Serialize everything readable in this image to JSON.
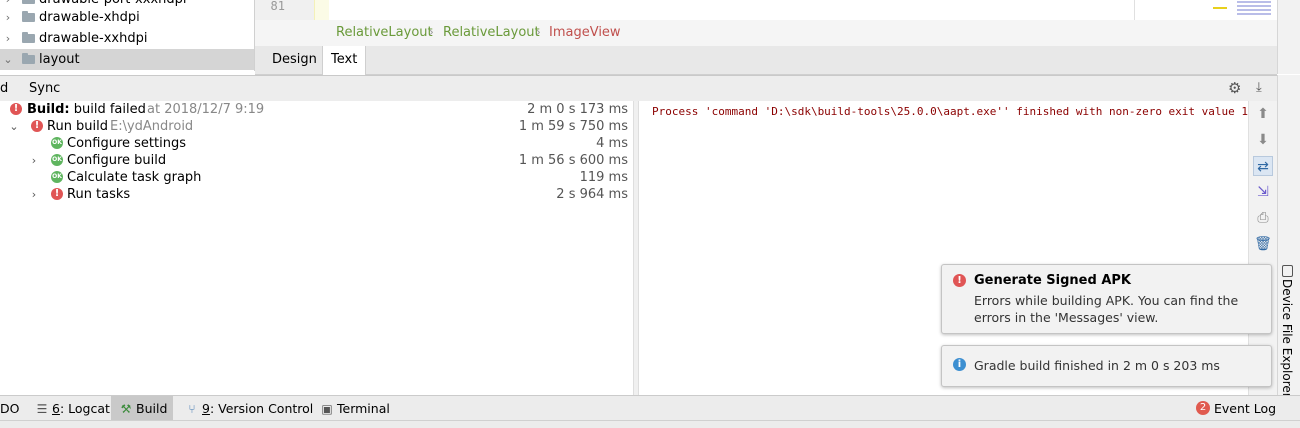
{
  "project_tree": {
    "items": [
      {
        "label": "drawable-port-xxxhdpi",
        "chevron": "›"
      },
      {
        "label": "drawable-xhdpi",
        "chevron": "›"
      },
      {
        "label": "drawable-xxhdpi",
        "chevron": "›"
      },
      {
        "label": "layout",
        "chevron": "⌄"
      }
    ]
  },
  "editor": {
    "line_number": "81",
    "breadcrumb": [
      "RelativeLayout",
      "RelativeLayout",
      "ImageView"
    ],
    "breadcrumb_colors": {
      "layout": "#6a9a3a",
      "view": "#c0504d"
    },
    "tabs": [
      "Design",
      "Text"
    ],
    "active_tab": "Text"
  },
  "build_window": {
    "header_tabs": [
      "d",
      "Sync"
    ],
    "tree": [
      {
        "name_bold": "Build:",
        "name": "build failed",
        "detail": "at 2018/12/7 9:19",
        "time": "2 m 0 s 173 ms",
        "status": "error"
      },
      {
        "name": "Run build",
        "detail": "E:\\ydAndroid",
        "time": "1 m 59 s 750 ms",
        "status": "error",
        "chevron": "⌄"
      },
      {
        "name": "Configure settings",
        "time": "4 ms",
        "status": "ok"
      },
      {
        "name": "Configure build",
        "time": "1 m 56 s 600 ms",
        "status": "ok",
        "chevron": "›"
      },
      {
        "name": "Calculate task graph",
        "time": "119 ms",
        "status": "ok"
      },
      {
        "name": "Run tasks",
        "time": "2 s 964 ms",
        "status": "error",
        "chevron": "›"
      }
    ],
    "ok_label": "OK",
    "error_label": "!",
    "console": "Process 'command 'D:\\sdk\\build-tools\\25.0.0\\aapt.exe'' finished with non-zero exit value 1"
  },
  "notifications": [
    {
      "title": "Generate Signed APK",
      "message": "Errors while building APK. You can find the errors in the 'Messages' view.",
      "type": "error",
      "color": "#e05555"
    },
    {
      "title": "",
      "message": "Gradle build finished in 2 m 0 s 203 ms",
      "type": "info",
      "color": "#3d8fd1"
    }
  ],
  "side_panel": {
    "device_file_explorer": "Device File Explorer"
  },
  "bottom_bar": {
    "todo": "DO",
    "logcat_num": "6",
    "logcat": ": Logcat",
    "build": "Build",
    "vcs_num": "9",
    "vcs": ": Version Control",
    "terminal": "Terminal",
    "event_count": "2",
    "event_log": "Event Log"
  }
}
